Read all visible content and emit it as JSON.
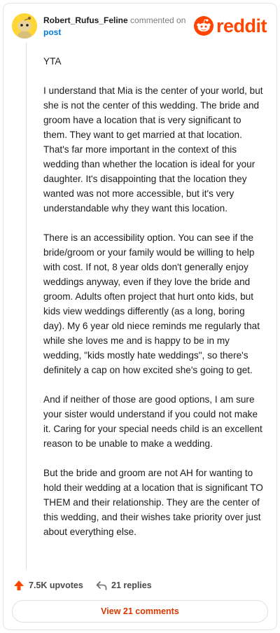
{
  "header": {
    "author": "Robert_Rufus_Feline",
    "action_text": "commented on",
    "post_link": "post",
    "brand": "reddit"
  },
  "comment": {
    "paragraphs": [
      "YTA",
      "I understand that Mia is the center of your world, but she is not the center of this wedding. The bride and groom have a location that is very significant to them. They want to get married at that location. That's far more important in the context of this wedding than whether the location is ideal for your daughter. It's disappointing that the location they wanted was not more accessible, but it's very understandable why they want this location.",
      "There is an accessibility option. You can see if the bride/groom or your family would be willing to help with cost. If not, 8 year olds don't generally enjoy weddings anyway, even if they love the bride and groom. Adults often project that hurt onto kids, but kids view weddings differently (as a long, boring day). My 6 year old niece reminds me regularly that while she loves me and is happy to be in my wedding, \"kids mostly hate weddings\", so there's definitely a cap on how excited she's going to get.",
      "And if neither of those are good options, I am sure your sister would understand if you could not make it. Caring for your special needs child is an excellent reason to be unable to make a wedding.",
      "But the bride and groom are not AH for wanting to hold their wedding at a location that is significant TO THEM and their relationship. They are the center of this wedding, and their wishes take priority over just about everything else."
    ]
  },
  "actions": {
    "upvotes": "7.5K upvotes",
    "replies": "21 replies",
    "view_comments": "View 21 comments"
  },
  "colors": {
    "brand": "#ff4500",
    "link": "#0079d3",
    "avatar": "#ffd635"
  },
  "icons": {
    "upvote": "arrow-up-icon",
    "reply": "reply-arrow-icon",
    "brand": "reddit-snoo-icon",
    "avatar": "snoo-avatar-icon"
  }
}
